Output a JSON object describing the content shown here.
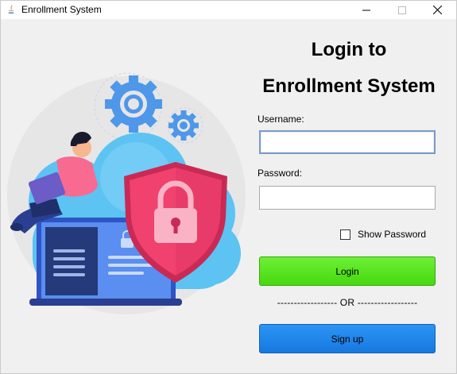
{
  "window": {
    "title": "Enrollment System",
    "controls": {
      "minimize": "minimize-icon",
      "maximize": "maximize-icon",
      "close": "close-icon"
    }
  },
  "login": {
    "heading_line1": "Login to",
    "heading_line2": "Enrollment System",
    "username_label": "Username:",
    "username_value": "",
    "password_label": "Password:",
    "password_value": "",
    "show_password_label": "Show Password",
    "show_password_checked": false,
    "login_button": "Login",
    "separator": "------------------ OR ------------------",
    "signup_button": "Sign up"
  },
  "colors": {
    "login_button": "#47d80f",
    "signup_button": "#1778e0",
    "shield": "#f0416f",
    "cloud": "#5cc3f2",
    "gear": "#4f97e8"
  }
}
